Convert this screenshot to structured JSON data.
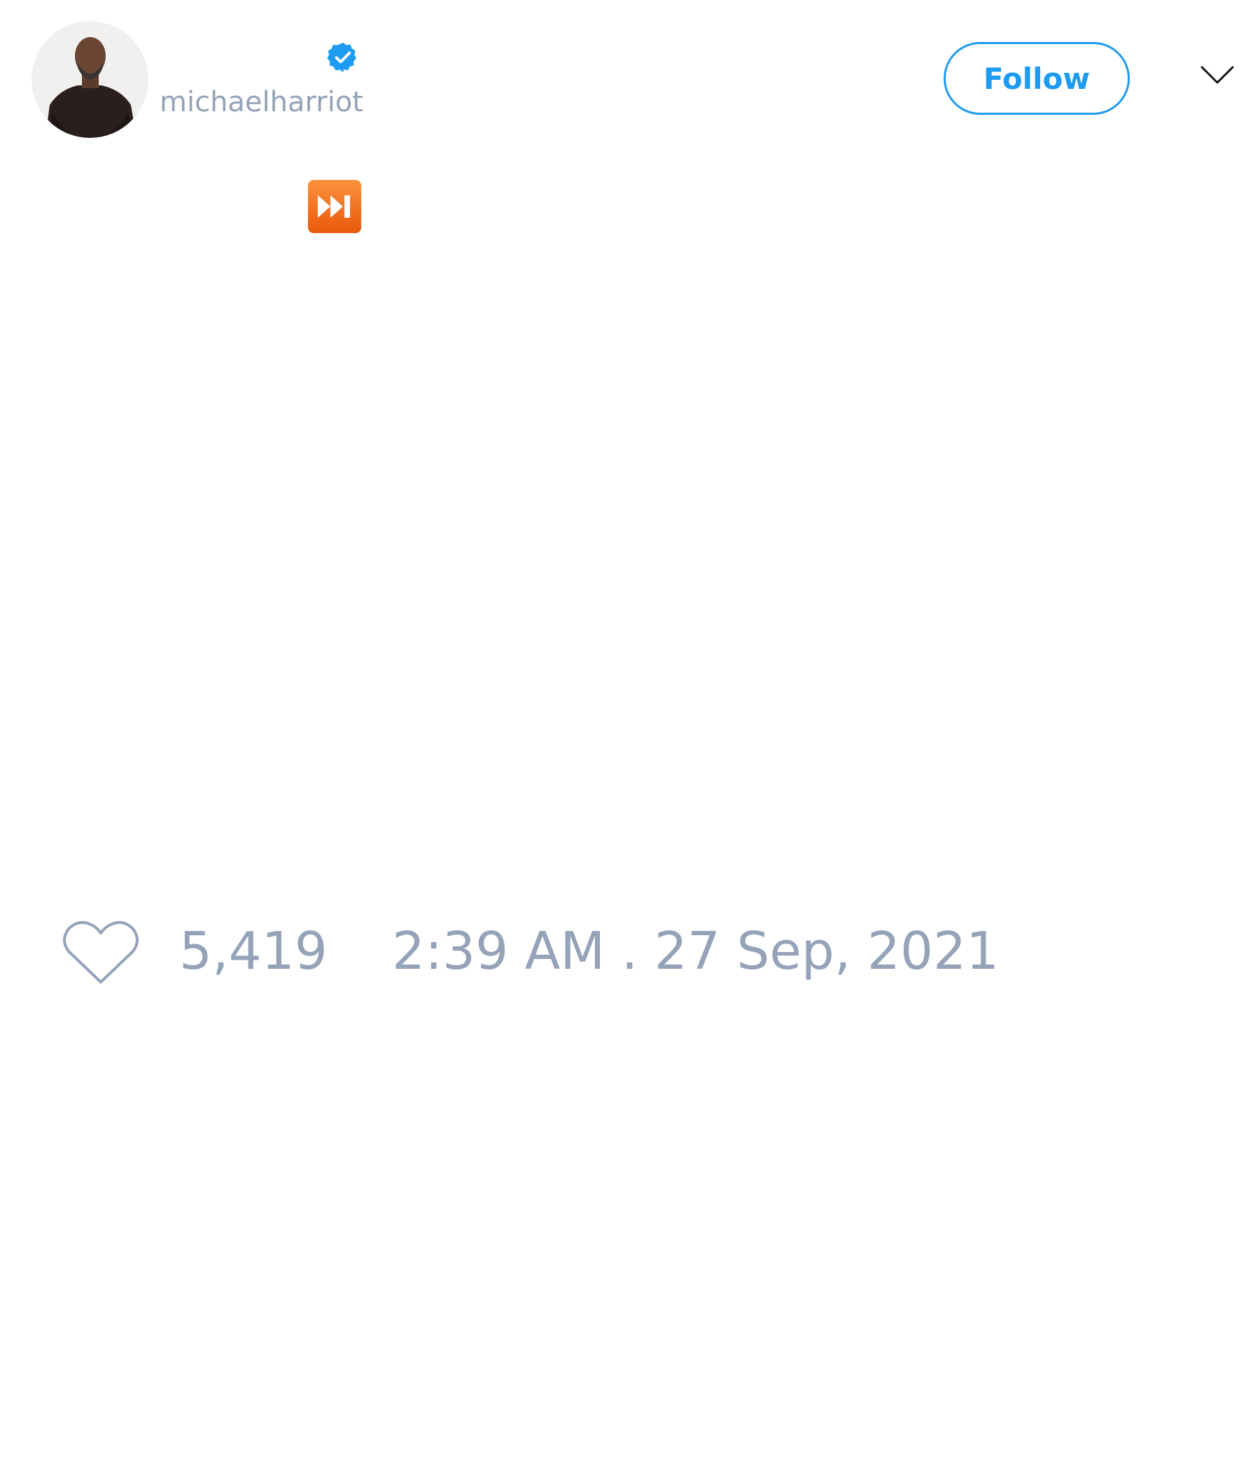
{
  "user": {
    "handle": "michaelharriot",
    "verified": true
  },
  "header": {
    "follow_label": "Follow",
    "menu_icon": "chevron-down-icon"
  },
  "tweet": {
    "emoji_icon": "fast-forward-emoji-icon"
  },
  "footer": {
    "like_icon": "heart-outline-icon",
    "like_count": "5,419",
    "timestamp": "2:39 AM . 27 Sep, 2021"
  },
  "colors": {
    "accent": "#1d9bf0",
    "muted_text": "#94a3b8",
    "emoji_orange": "#f97316"
  }
}
